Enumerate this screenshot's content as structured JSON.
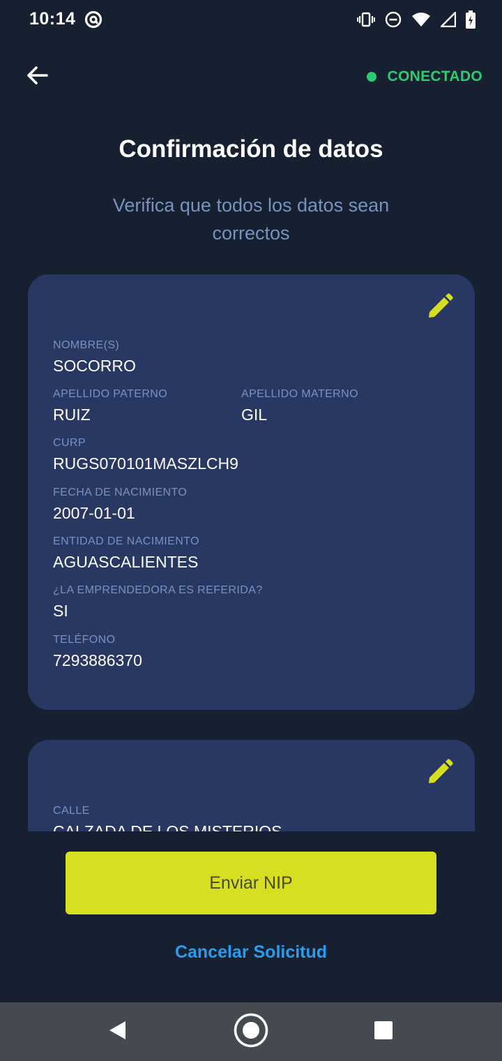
{
  "status_bar": {
    "time": "10:14",
    "icons": [
      "at-sign-icon",
      "vibrate-icon",
      "do-not-disturb-icon",
      "wifi-icon",
      "signal-icon",
      "battery-charging-icon"
    ]
  },
  "header": {
    "connection_status": "CONECTADO",
    "connection_color": "#2ecc71"
  },
  "page": {
    "title": "Confirmación de datos",
    "subtitle": "Verifica que todos los datos sean correctos"
  },
  "personal_card": {
    "nombre_label": "NOMBRE(S)",
    "nombre_value": "SOCORRO",
    "apellido_paterno_label": "APELLIDO PATERNO",
    "apellido_paterno_value": "RUIZ",
    "apellido_materno_label": "APELLIDO MATERNO",
    "apellido_materno_value": "GIL",
    "curp_label": "CURP",
    "curp_value": "RUGS070101MASZLCH9",
    "fecha_label": "FECHA DE NACIMIENTO",
    "fecha_value": "2007-01-01",
    "entidad_label": "ENTIDAD DE NACIMIENTO",
    "entidad_value": "AGUASCALIENTES",
    "referida_label": "¿LA EMPRENDEDORA ES REFERIDA?",
    "referida_value": "SI",
    "telefono_label": "TELÉFONO",
    "telefono_value": "7293886370"
  },
  "address_card": {
    "calle_label": "CALLE",
    "calle_value": "CALZADA DE LOS MISTERIOS"
  },
  "actions": {
    "primary_label": "Enviar NIP",
    "cancel_label": "Cancelar Solicitud"
  },
  "colors": {
    "background": "#172030",
    "card": "#293862",
    "accent": "#d6e020",
    "label": "#7892c0",
    "link": "#2a9cf0"
  }
}
